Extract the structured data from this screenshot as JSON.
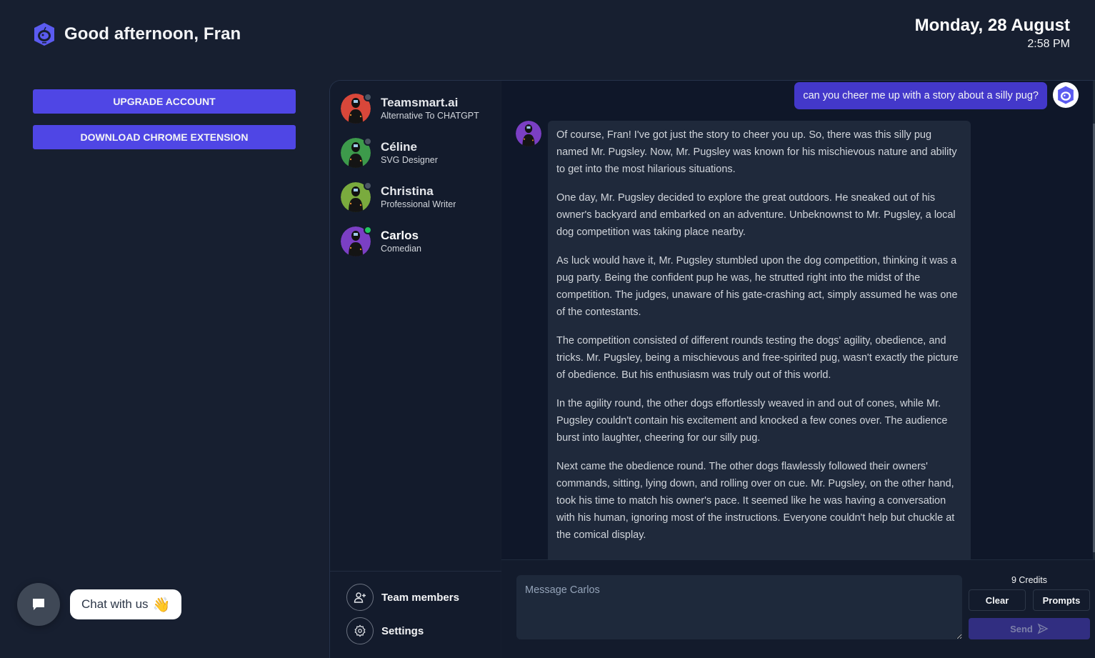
{
  "header": {
    "greeting": "Good afternoon, Fran",
    "date": "Monday, 28 August",
    "time": "2:58 PM"
  },
  "sidebar": {
    "upgrade_label": "UPGRADE ACCOUNT",
    "chrome_label": "DOWNLOAD CHROME EXTENSION"
  },
  "chat_widget": {
    "label": "Chat with us",
    "emoji": "👋"
  },
  "contacts": [
    {
      "name": "Teamsmart.ai",
      "role": "Alternative To CHATGPT",
      "avatar_color": "#d9473a",
      "status": "offline"
    },
    {
      "name": "Céline",
      "role": "SVG Designer",
      "avatar_color": "#3d9a4b",
      "status": "offline"
    },
    {
      "name": "Christina",
      "role": "Professional Writer",
      "avatar_color": "#7aab3e",
      "status": "offline"
    },
    {
      "name": "Carlos",
      "role": "Comedian",
      "avatar_color": "#7b3fc4",
      "status": "online"
    }
  ],
  "footer": {
    "team_members": "Team members",
    "settings": "Settings"
  },
  "conversation": {
    "user_message": "can you cheer me up with a story about a silly pug?",
    "bot_paragraphs": [
      "Of course, Fran! I've got just the story to cheer you up. So, there was this silly pug named Mr. Pugsley. Now, Mr. Pugsley was known for his mischievous nature and ability to get into the most hilarious situations.",
      "One day, Mr. Pugsley decided to explore the great outdoors. He sneaked out of his owner's backyard and embarked on an adventure. Unbeknownst to Mr. Pugsley, a local dog competition was taking place nearby.",
      "As luck would have it, Mr. Pugsley stumbled upon the dog competition, thinking it was a pug party. Being the confident pup he was, he strutted right into the midst of the competition. The judges, unaware of his gate-crashing act, simply assumed he was one of the contestants.",
      "The competition consisted of different rounds testing the dogs' agility, obedience, and tricks. Mr. Pugsley, being a mischievous and free-spirited pug, wasn't exactly the picture of obedience. But his enthusiasm was truly out of this world.",
      "In the agility round, the other dogs effortlessly weaved in and out of cones, while Mr. Pugsley couldn't contain his excitement and knocked a few cones over. The audience burst into laughter, cheering for our silly pug.",
      "Next came the obedience round. The other dogs flawlessly followed their owners' commands, sitting, lying down, and rolling over on cue. Mr. Pugsley, on the other hand, took his time to match his owner's pace. It seemed like he was having a conversation with his human, ignoring most of the instructions. Everyone couldn't help but chuckle at the comical display."
    ]
  },
  "composer": {
    "placeholder": "Message Carlos",
    "value": "",
    "credits": "9 Credits",
    "clear_label": "Clear",
    "prompts_label": "Prompts",
    "send_label": "Send"
  },
  "colors": {
    "accent": "#4f46e5",
    "background": "#171f30",
    "online": "#22c55e"
  }
}
